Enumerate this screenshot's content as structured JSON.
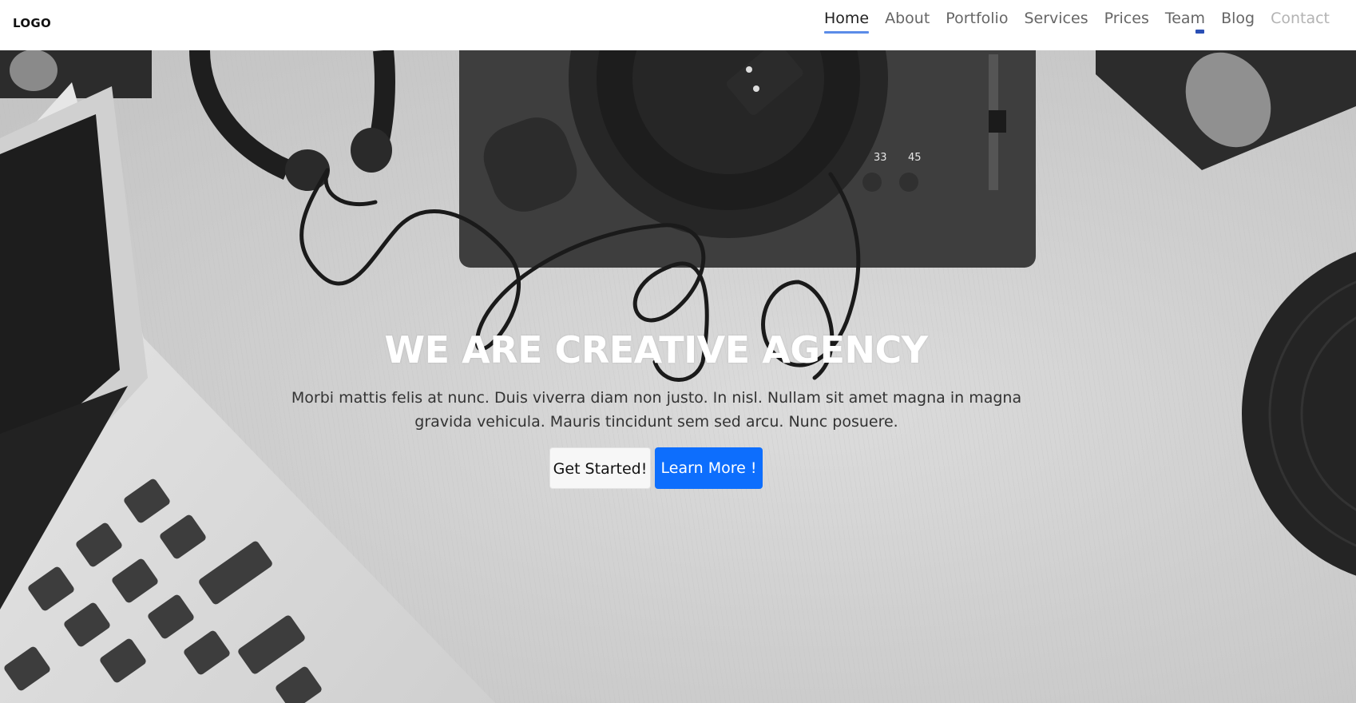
{
  "navbar": {
    "logo": "LOGO",
    "items": [
      {
        "label": "Home",
        "active": true
      },
      {
        "label": "About"
      },
      {
        "label": "Portfolio"
      },
      {
        "label": "Services"
      },
      {
        "label": "Prices"
      },
      {
        "label": "Team"
      },
      {
        "label": "Blog"
      },
      {
        "label": "Contact",
        "muted": true
      }
    ],
    "active_color": "#5b8ce8"
  },
  "hero": {
    "title": "WE ARE CREATIVE AGENCY",
    "subtitle": "Morbi mattis felis at nunc. Duis viverra diam non justo. In nisl. Nullam sit amet magna in magna gravida vehicula. Mauris tincidunt sem sed arcu. Nunc posuere.",
    "buttons": {
      "primary_outline": "Get Started!",
      "primary": "Learn More !"
    },
    "turntable_labels": [
      "33",
      "45"
    ],
    "primary_color": "#0d6efd"
  }
}
